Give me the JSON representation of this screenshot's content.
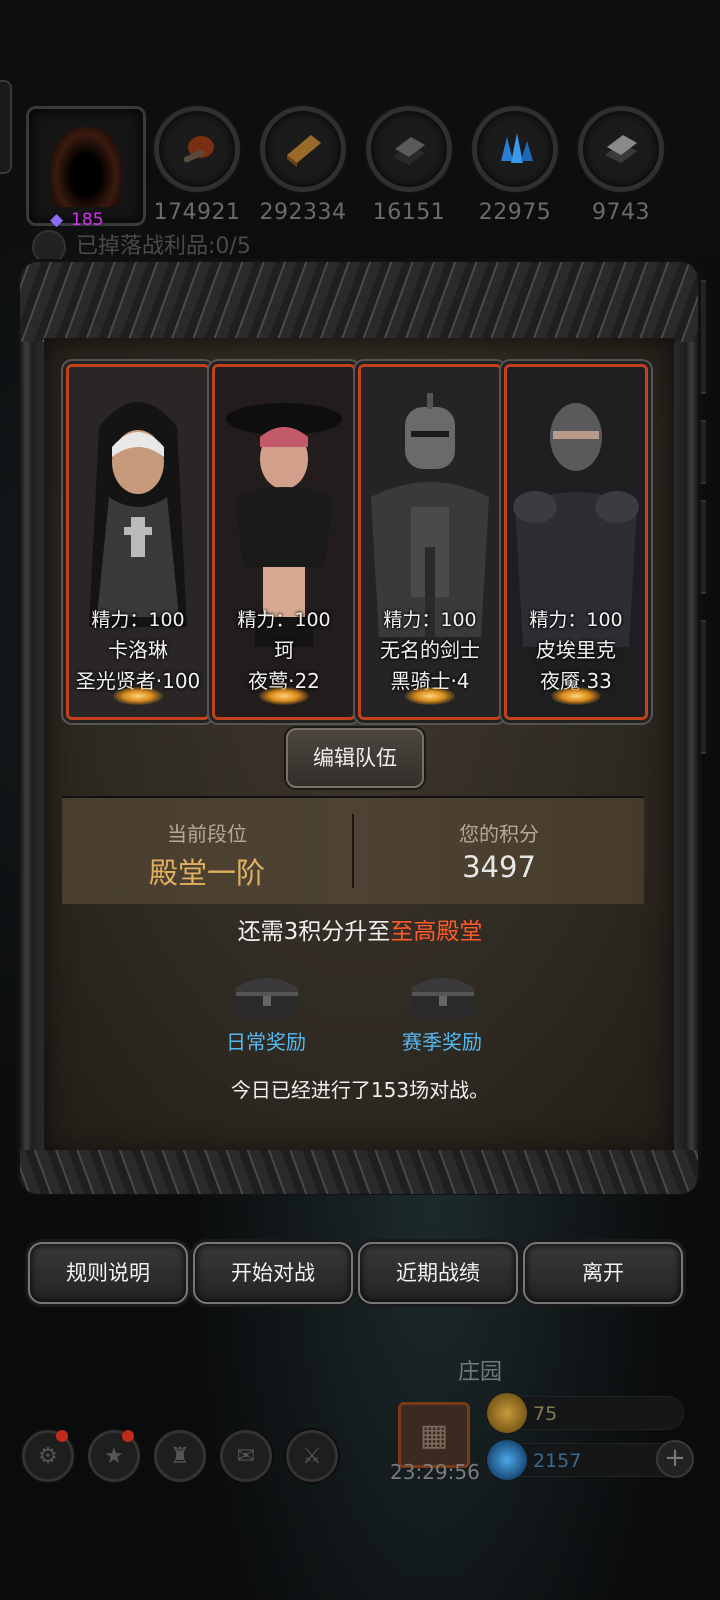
{
  "resources": [
    {
      "icon": "leather-icon",
      "value": "174921",
      "color": "#8a3a1a"
    },
    {
      "icon": "wood-icon",
      "value": "292334",
      "color": "#9a6a2a"
    },
    {
      "icon": "iron-ingot-icon",
      "value": "16151",
      "color": "#6a6a6a"
    },
    {
      "icon": "crystal-icon",
      "value": "22975",
      "color": "#2a8ad8"
    },
    {
      "icon": "steel-ingot-icon",
      "value": "9743",
      "color": "#8a8a8a"
    }
  ],
  "gem_count": "185",
  "loot_text": "已掉落战利品:0/5",
  "heroes": [
    {
      "energy": "精力：100",
      "name": "卡洛琳",
      "class_level": "圣光贤者·100"
    },
    {
      "energy": "精力：100",
      "name": "珂",
      "class_level": "夜莺·22"
    },
    {
      "energy": "精力：100",
      "name": "无名的剑士",
      "class_level": "黑骑士·4"
    },
    {
      "energy": "精力：100",
      "name": "皮埃里克",
      "class_level": "夜魇·33"
    }
  ],
  "edit_team_label": "编辑队伍",
  "rank": {
    "current_label": "当前段位",
    "current_value": "殿堂一阶",
    "score_label": "您的积分",
    "score_value": "3497"
  },
  "promotion": {
    "prefix": "还需3积分升至",
    "target": "至高殿堂"
  },
  "rewards": {
    "daily_label": "日常奖励",
    "season_label": "赛季奖励"
  },
  "today_text": "今日已经进行了153场对战。",
  "actions": {
    "rules": "规则说明",
    "start": "开始对战",
    "history": "近期战绩",
    "leave": "离开"
  },
  "bottom": {
    "estate_label": "庄园",
    "timer": "23:29:56",
    "gold": "75",
    "blue_currency": "2157"
  },
  "colors": {
    "accent_orange": "#ff5a2c",
    "rank_gold": "#e0b060",
    "reward_blue": "#56b8f0",
    "gem_purple": "#d033f0"
  }
}
